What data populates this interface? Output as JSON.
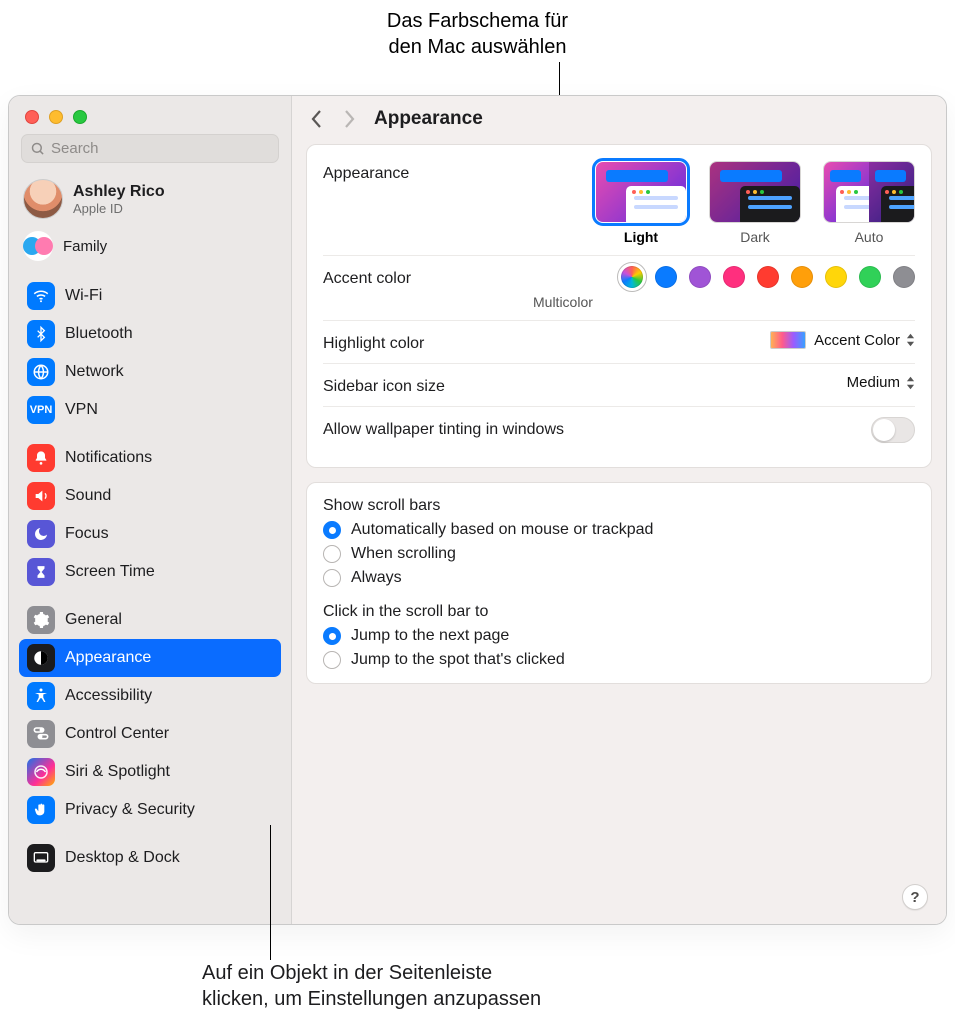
{
  "annotations": {
    "top": "Das Farbschema für\nden Mac auswählen",
    "bottom": "Auf ein Objekt in der Seitenleiste\nklicken, um Einstellungen anzupassen"
  },
  "search": {
    "placeholder": "Search"
  },
  "account": {
    "name": "Ashley Rico",
    "sub": "Apple ID"
  },
  "family": {
    "label": "Family"
  },
  "sidebar": {
    "group1": [
      {
        "label": "Wi-Fi",
        "icon": "wifi-icon",
        "bg": "bg-blue"
      },
      {
        "label": "Bluetooth",
        "icon": "bluetooth-icon",
        "bg": "bg-blue"
      },
      {
        "label": "Network",
        "icon": "globe-icon",
        "bg": "bg-blue"
      },
      {
        "label": "VPN",
        "icon": "vpn-icon",
        "bg": "bg-blue"
      }
    ],
    "group2": [
      {
        "label": "Notifications",
        "icon": "bell-icon",
        "bg": "bg-red"
      },
      {
        "label": "Sound",
        "icon": "speaker-icon",
        "bg": "bg-red"
      },
      {
        "label": "Focus",
        "icon": "moon-icon",
        "bg": "bg-purple"
      },
      {
        "label": "Screen Time",
        "icon": "hourglass-icon",
        "bg": "bg-purple"
      }
    ],
    "group3": [
      {
        "label": "General",
        "icon": "gear-icon",
        "bg": "bg-gray"
      },
      {
        "label": "Appearance",
        "icon": "appearance-icon",
        "bg": "bg-black",
        "selected": true
      },
      {
        "label": "Accessibility",
        "icon": "accessibility-icon",
        "bg": "bg-blue"
      },
      {
        "label": "Control Center",
        "icon": "switches-icon",
        "bg": "bg-gray"
      },
      {
        "label": "Siri & Spotlight",
        "icon": "siri-icon",
        "bg": "bg-siri"
      },
      {
        "label": "Privacy & Security",
        "icon": "hand-icon",
        "bg": "bg-hand"
      }
    ],
    "group4": [
      {
        "label": "Desktop & Dock",
        "icon": "dock-icon",
        "bg": "bg-black"
      }
    ]
  },
  "header": {
    "title": "Appearance"
  },
  "appearance": {
    "label": "Appearance",
    "options": [
      {
        "label": "Light",
        "selected": true
      },
      {
        "label": "Dark"
      },
      {
        "label": "Auto"
      }
    ]
  },
  "accent": {
    "label": "Accent color",
    "sub": "Multicolor",
    "colors": [
      "multi",
      "#0a7bff",
      "#a054d6",
      "#ff2f7e",
      "#ff3b30",
      "#ff9f0a",
      "#ffd60a",
      "#30d158",
      "#8e8e93"
    ],
    "selectedIndex": 0
  },
  "highlight": {
    "label": "Highlight color",
    "value": "Accent Color"
  },
  "iconsize": {
    "label": "Sidebar icon size",
    "value": "Medium"
  },
  "wallpaper": {
    "label": "Allow wallpaper tinting in windows",
    "on": false
  },
  "scrollbars": {
    "heading": "Show scroll bars",
    "options": [
      "Automatically based on mouse or trackpad",
      "When scrolling",
      "Always"
    ],
    "selectedIndex": 0
  },
  "clickbar": {
    "heading": "Click in the scroll bar to",
    "options": [
      "Jump to the next page",
      "Jump to the spot that's clicked"
    ],
    "selectedIndex": 0
  },
  "help": "?"
}
